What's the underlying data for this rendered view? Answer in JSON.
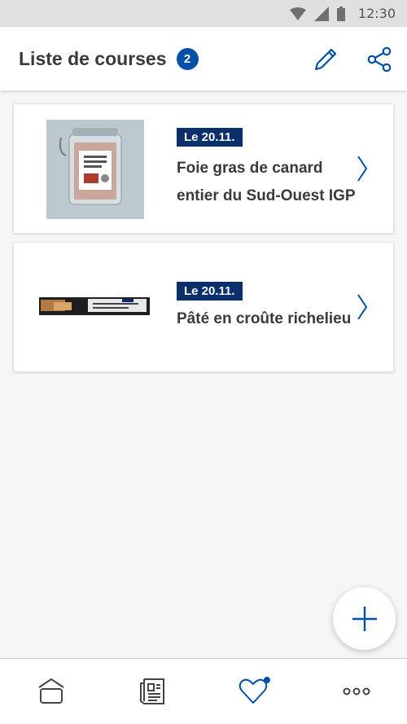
{
  "status_bar": {
    "time": "12:30",
    "icons": [
      "wifi-icon",
      "signal-icon",
      "battery-icon"
    ]
  },
  "header": {
    "title": "Liste de courses",
    "count": "2",
    "actions": [
      "pencil-icon",
      "share-icon"
    ]
  },
  "items": [
    {
      "date": "Le 20.11.",
      "name_lines": [
        "Foie gras de canard",
        "entier du Sud-Ouest IGP"
      ],
      "image": "foie-gras-jar-image"
    },
    {
      "date": "Le 20.11.",
      "name_lines": [
        "Pâté en croûte richelieu"
      ],
      "image": "pate-en-croute-package-image"
    }
  ],
  "fab": {
    "icon": "plus-icon"
  },
  "bottom_nav": {
    "items": [
      "home-icon",
      "brochure-icon",
      "heart-icon",
      "more-icon"
    ],
    "active": "heart-icon"
  },
  "colors": {
    "accent": "#0050aa",
    "date_badge": "#0a2f6b",
    "notification_dot": "#0050aa"
  }
}
